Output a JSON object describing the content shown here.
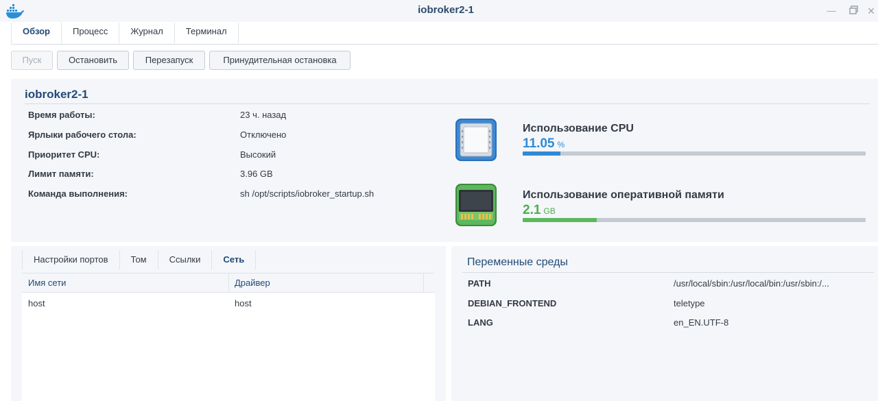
{
  "window": {
    "title": "iobroker2-1",
    "app_icon": "docker-whale-icon"
  },
  "tabs": [
    {
      "label": "Обзор",
      "active": true
    },
    {
      "label": "Процесс",
      "active": false
    },
    {
      "label": "Журнал",
      "active": false
    },
    {
      "label": "Терминал",
      "active": false
    }
  ],
  "toolbar": {
    "start": "Пуск",
    "stop": "Остановить",
    "restart": "Перезапуск",
    "force_stop": "Принудительная остановка"
  },
  "overview": {
    "title": "iobroker2-1",
    "rows": [
      {
        "label": "Время работы:",
        "value": "23 ч. назад"
      },
      {
        "label": "Ярлыки рабочего стола:",
        "value": "Отключено"
      },
      {
        "label": "Приоритет CPU:",
        "value": "Высокий"
      },
      {
        "label": "Лимит памяти:",
        "value": "3.96 GB"
      },
      {
        "label": "Команда выполнения:",
        "value": "sh /opt/scripts/iobroker_startup.sh"
      }
    ],
    "cpu": {
      "title": "Использование CPU",
      "value": "11.05",
      "unit": "%",
      "fraction": 0.11,
      "color": "#2f8ad6",
      "icon": "cpu-chip-icon"
    },
    "ram": {
      "title": "Использование оперативной памяти",
      "value": "2.1",
      "unit": "GB",
      "fraction": 0.215,
      "color": "#5cb85c",
      "icon": "ram-module-icon"
    }
  },
  "subtabs": [
    {
      "label": "Настройки портов",
      "active": false
    },
    {
      "label": "Том",
      "active": false
    },
    {
      "label": "Ссылки",
      "active": false
    },
    {
      "label": "Сеть",
      "active": true
    }
  ],
  "network_table": {
    "columns": [
      "Имя сети",
      "Драйвер"
    ],
    "rows": [
      [
        "host",
        "host"
      ]
    ]
  },
  "env": {
    "title": "Переменные среды",
    "rows": [
      {
        "key": "PATH",
        "value": "/usr/local/sbin:/usr/local/bin:/usr/sbin:/..."
      },
      {
        "key": "DEBIAN_FRONTEND",
        "value": "teletype"
      },
      {
        "key": "LANG",
        "value": "en_EN.UTF-8"
      }
    ]
  }
}
